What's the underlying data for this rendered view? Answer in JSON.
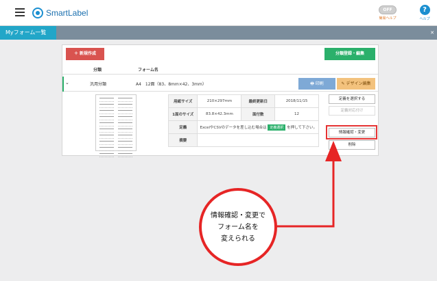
{
  "header": {
    "brand": "SmartLabel",
    "toggle_label": "OFF",
    "toggle_caption": "簡易ヘルプ",
    "help_glyph": "?",
    "help_caption": "ヘルプ"
  },
  "tabs": {
    "active_label": "Myフォーム一覧",
    "close_glyph": "✕"
  },
  "toolbar": {
    "new_label": "＋ 新規作成",
    "category_label": "分類登録・編集"
  },
  "table": {
    "col_category": "分類",
    "col_form_name": "フォーム名"
  },
  "row": {
    "category": "汎用分類",
    "form_name": "A4　12面（83、8mm×42、3mm）",
    "print_label": "🖶 印刷",
    "design_label": "✎ デザイン編集"
  },
  "details": {
    "paper_size_label": "用紙サイズ",
    "paper_size_value": "210×297mm",
    "updated_label": "最終更新日",
    "updated_value": "2018/11/15",
    "face_size_label": "1面のサイズ",
    "face_size_value": "83.8×42.3mm",
    "face_count_label": "面付数",
    "face_count_value": "12",
    "definition_label": "定義",
    "definition_text_before": "ExcelやCSVのデータを差し込む場合は",
    "definition_chip": "定義選択",
    "definition_text_after": "を押して下さい。",
    "summary_label": "摘要"
  },
  "side_actions": {
    "select_definition": "定義を選択する",
    "definition_map": "定義対応付け",
    "info_change": "情報確認・変更",
    "delete": "削除"
  },
  "callout": {
    "line1": "情報確認・変更で",
    "line2": "フォーム名を",
    "line3": "変えられる"
  },
  "colors": {
    "accent": "#1a8fd0",
    "tab_active": "#22a6c8",
    "new_button": "#d9534f",
    "category_button": "#2bb06b",
    "callout_border": "#e62525"
  }
}
